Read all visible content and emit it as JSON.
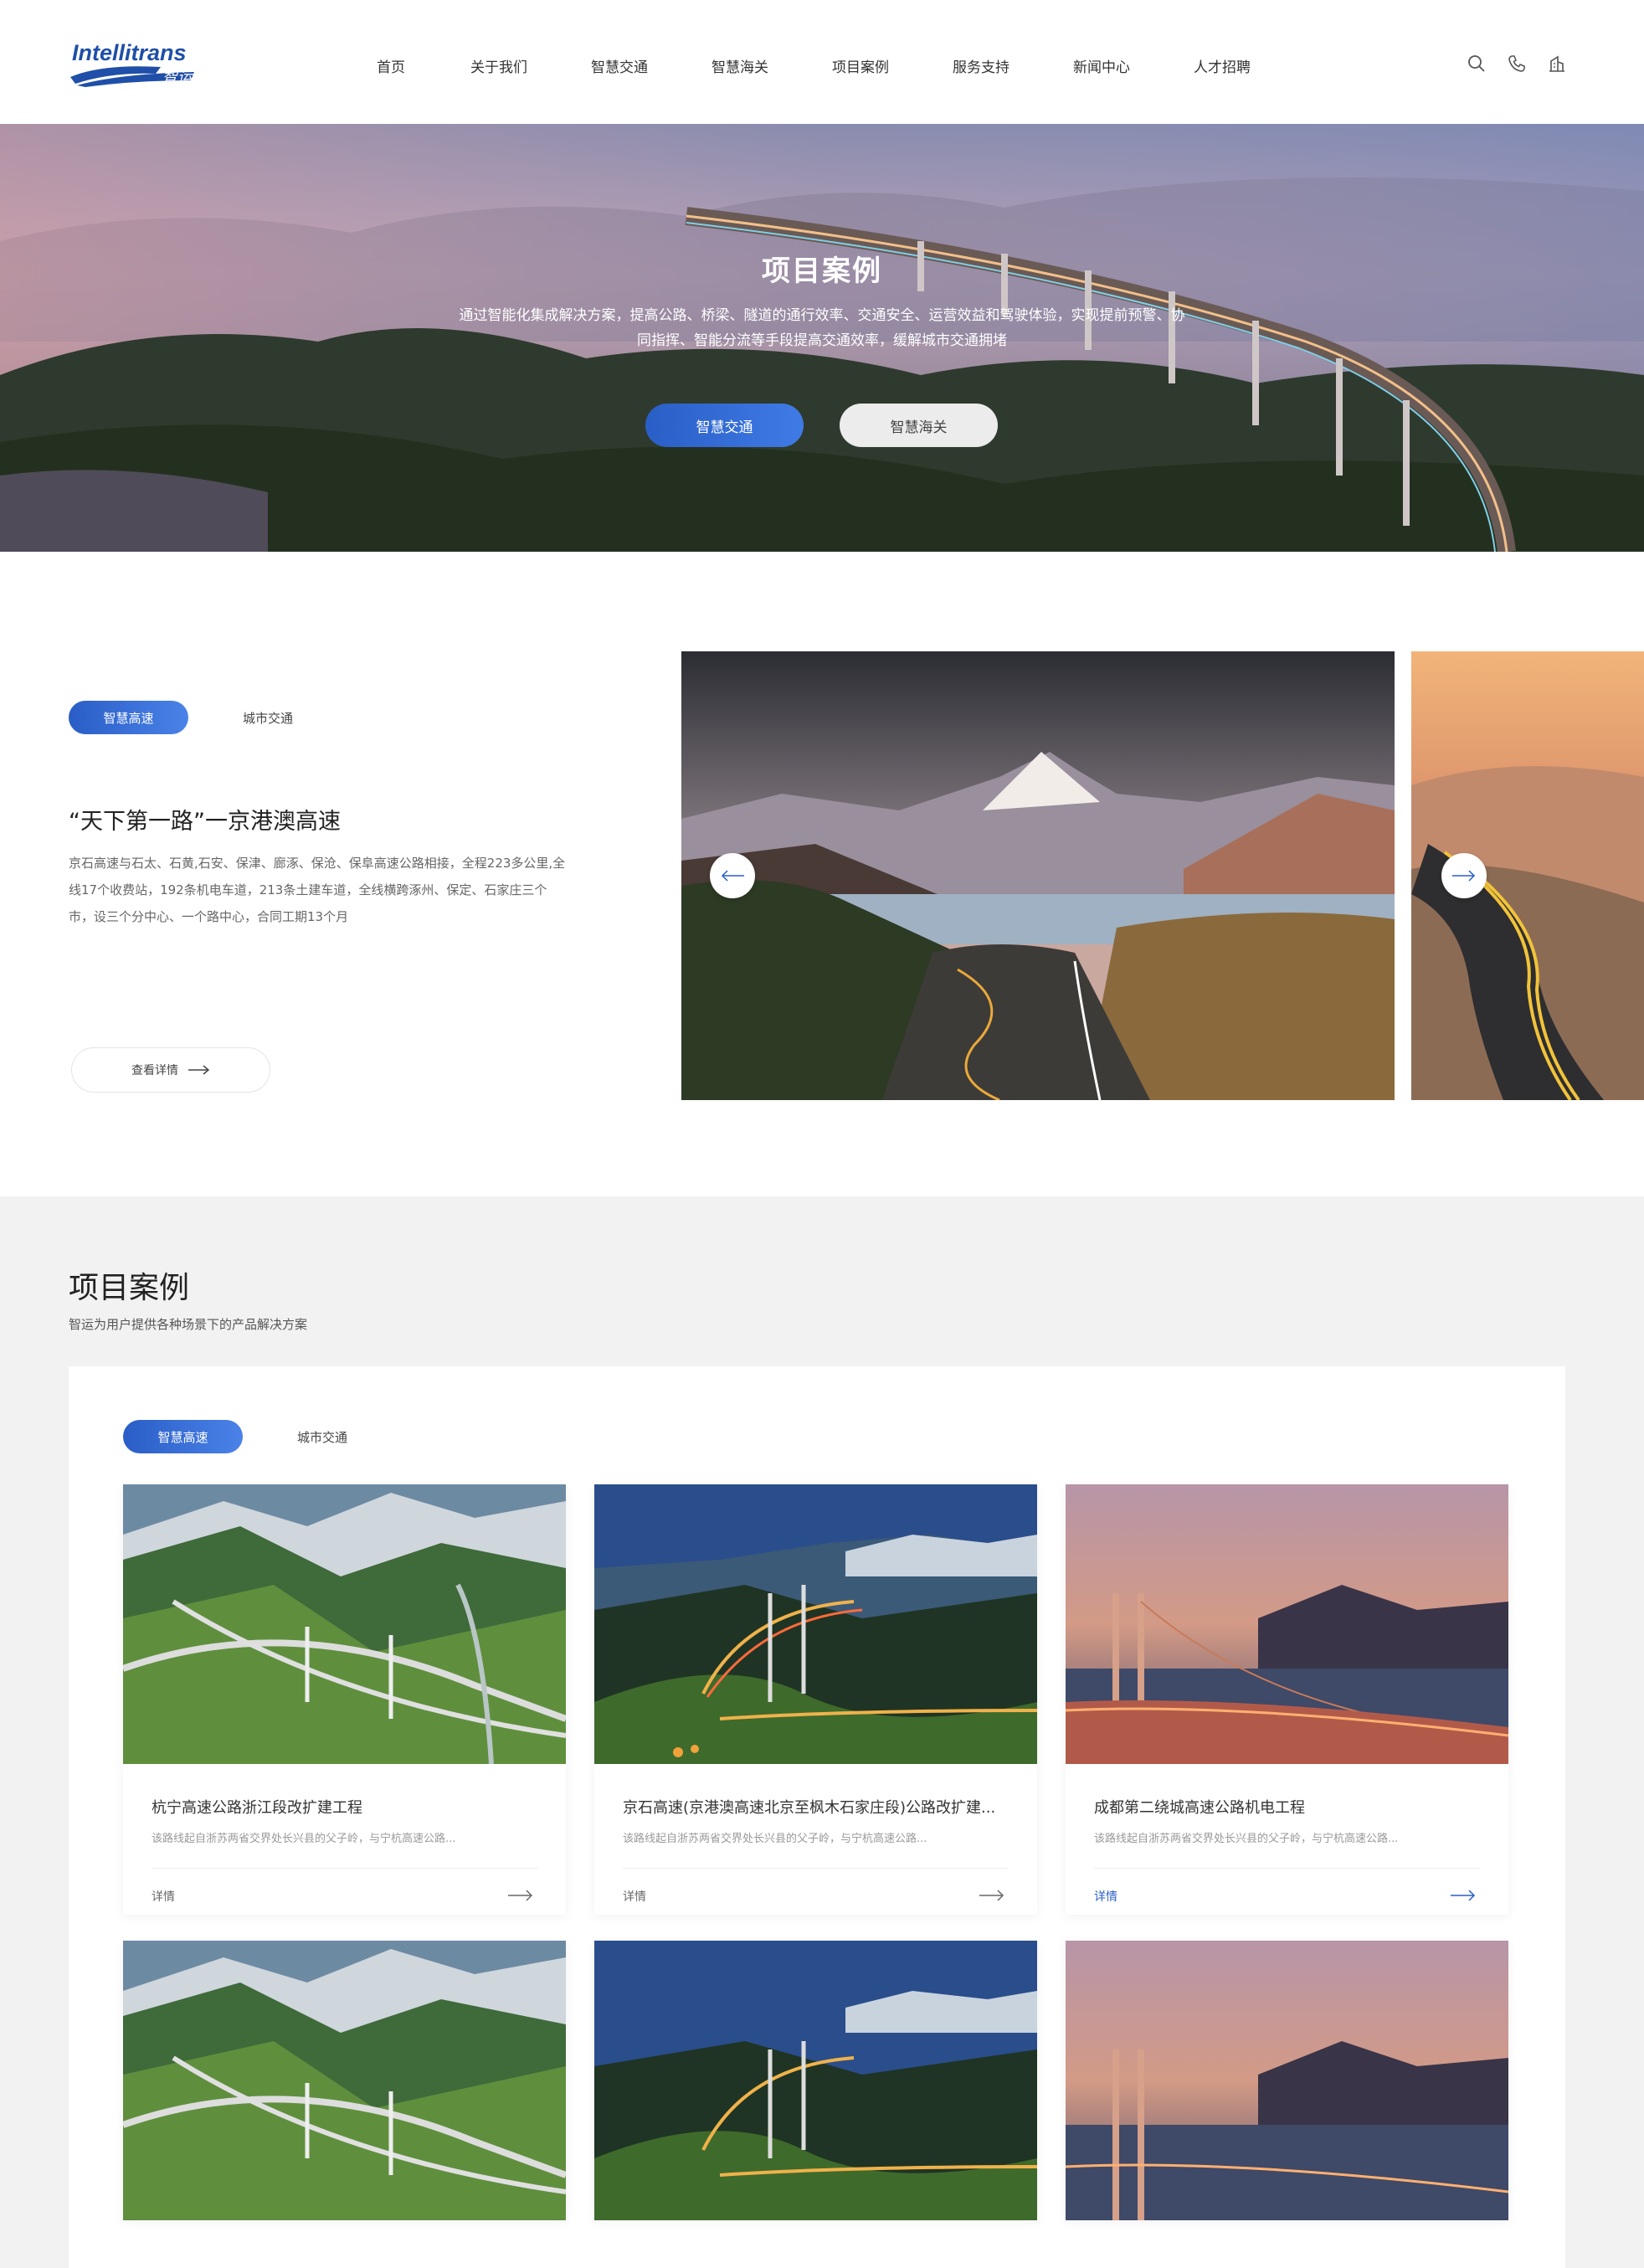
{
  "brand": {
    "logo_text": "Intellitrans",
    "logo_sub": "智运",
    "color": "#1f4fa8"
  },
  "nav": {
    "items": [
      "首页",
      "关于我们",
      "智慧交通",
      "智慧海关",
      "项目案例",
      "服务支持",
      "新闻中心",
      "人才招聘"
    ]
  },
  "header_icons": [
    "search-icon",
    "phone-icon",
    "building-icon"
  ],
  "hero": {
    "title": "项目案例",
    "desc_line1": "通过智能化集成解决方案，提高公路、桥梁、隧道的通行效率、交通安全、运营效益和驾驶体验，实现提前预警、协",
    "desc_line2": "同指挥、智能分流等手段提高交通效率，缓解城市交通拥堵",
    "btn_primary": "智慧交通",
    "btn_secondary": "智慧海关"
  },
  "featured": {
    "tab_active": "智慧高速",
    "tab_other": "城市交通",
    "title": "“天下第一路”一京港澳高速",
    "desc": "京石高速与石太、石黄,石安、保津、廊涿、保沧、保阜高速公路相接，全程223多公里,全线17个收费站，192条机电车道，213条土建车道，全线横跨涿州、保定、石家庄三个市，设三个分中心、一个路中心，合同工期13个月",
    "detail_label": "查看详情",
    "prev_icon": "arrow-left-icon",
    "next_icon": "arrow-right-icon"
  },
  "cases": {
    "title": "项目案例",
    "subtitle": "智运为用户提供各种场景下的产品解决方案",
    "tab_active": "智慧高速",
    "tab_other": "城市交通",
    "more_label": "详情",
    "accent": "#2a5ec6",
    "items": [
      {
        "title": "杭宁高速公路浙江段改扩建工程",
        "desc": "该路线起自浙苏两省交界处长兴县的父子岭，与宁杭高速公路..."
      },
      {
        "title": "京石高速(京港澳高速北京至枫木石家庄段)公路改扩建...",
        "desc": "该路线起自浙苏两省交界处长兴县的父子岭，与宁杭高速公路..."
      },
      {
        "title": "成都第二绕城高速公路机电工程",
        "desc": "该路线起自浙苏两省交界处长兴县的父子岭，与宁杭高速公路..."
      }
    ]
  }
}
